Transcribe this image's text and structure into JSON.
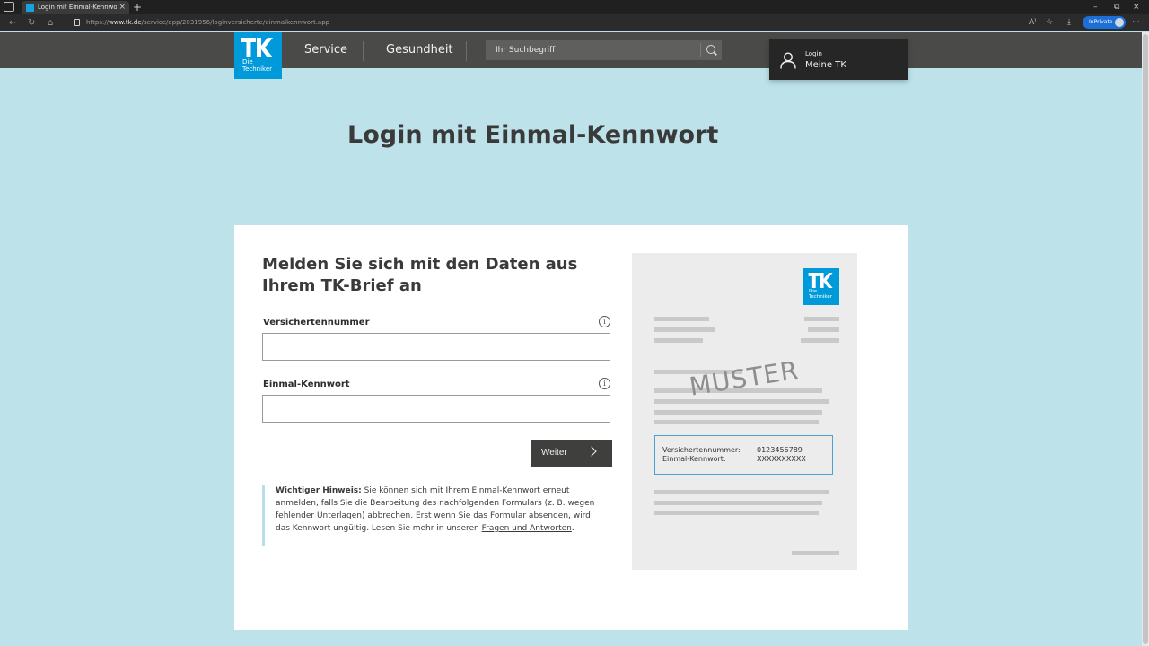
{
  "browser": {
    "tab_title": "Login mit Einmal-Kennwort | Die",
    "tab_close": "×",
    "new_tab": "+",
    "url_scheme": "https://",
    "url_host": "www.tk.de",
    "url_path": "/service/app/2031956/loginversicherte/einmalkennwort.app",
    "inprivate_label": "InPrivate",
    "window_minimize": "–",
    "window_restore": "⧉",
    "window_close": "×",
    "back_icon": "←",
    "refresh_icon": "↻",
    "home_icon": "⌂",
    "read_aloud_icon": "A⁾",
    "favorites_icon": "☆",
    "downloads_icon": "⤓",
    "more_icon": "···"
  },
  "header": {
    "logo_text_line1": "Die",
    "logo_text_line2": "Techniker",
    "nav": [
      "Service",
      "Gesundheit"
    ],
    "search_placeholder": "Ihr Suchbegriff",
    "login_small": "Login",
    "login_big": "Meine TK"
  },
  "page": {
    "title": "Login mit Einmal-Kennwort"
  },
  "form": {
    "heading": "Melden Sie sich mit den Daten aus Ihrem TK-Brief an",
    "fields": [
      {
        "label": "Versichertennummer",
        "value": "",
        "info": "i"
      },
      {
        "label": "Einmal-Kennwort",
        "value": "",
        "info": "i"
      }
    ],
    "submit_label": "Weiter",
    "notice": {
      "strong": "Wichtiger Hinweis:",
      "text": " Sie können sich mit Ihrem Einmal-Kennwort erneut anmelden, falls Sie die Bearbeitung des nachfolgenden Formulars  (z. B. wegen fehlender Unterlagen) abbrechen. Erst wenn Sie das Formular absenden, wird das Kennwort ungültig. Lesen Sie mehr in unseren ",
      "link": "Fragen und Antworten",
      "end": "."
    }
  },
  "sample_letter": {
    "logo_text_line1": "Die",
    "logo_text_line2": "Techniker",
    "watermark": "MUSTER",
    "rows": [
      {
        "label": "Versichertennummer:",
        "value": "0123456789"
      },
      {
        "label": "Einmal-Kennwort:",
        "value": "XXXXXXXXXX"
      }
    ]
  },
  "colors": {
    "page_background": "#bde2ea",
    "header_background": "#4a4a48",
    "brand_blue": "#0099da",
    "button_dark": "#3f3f3d"
  }
}
